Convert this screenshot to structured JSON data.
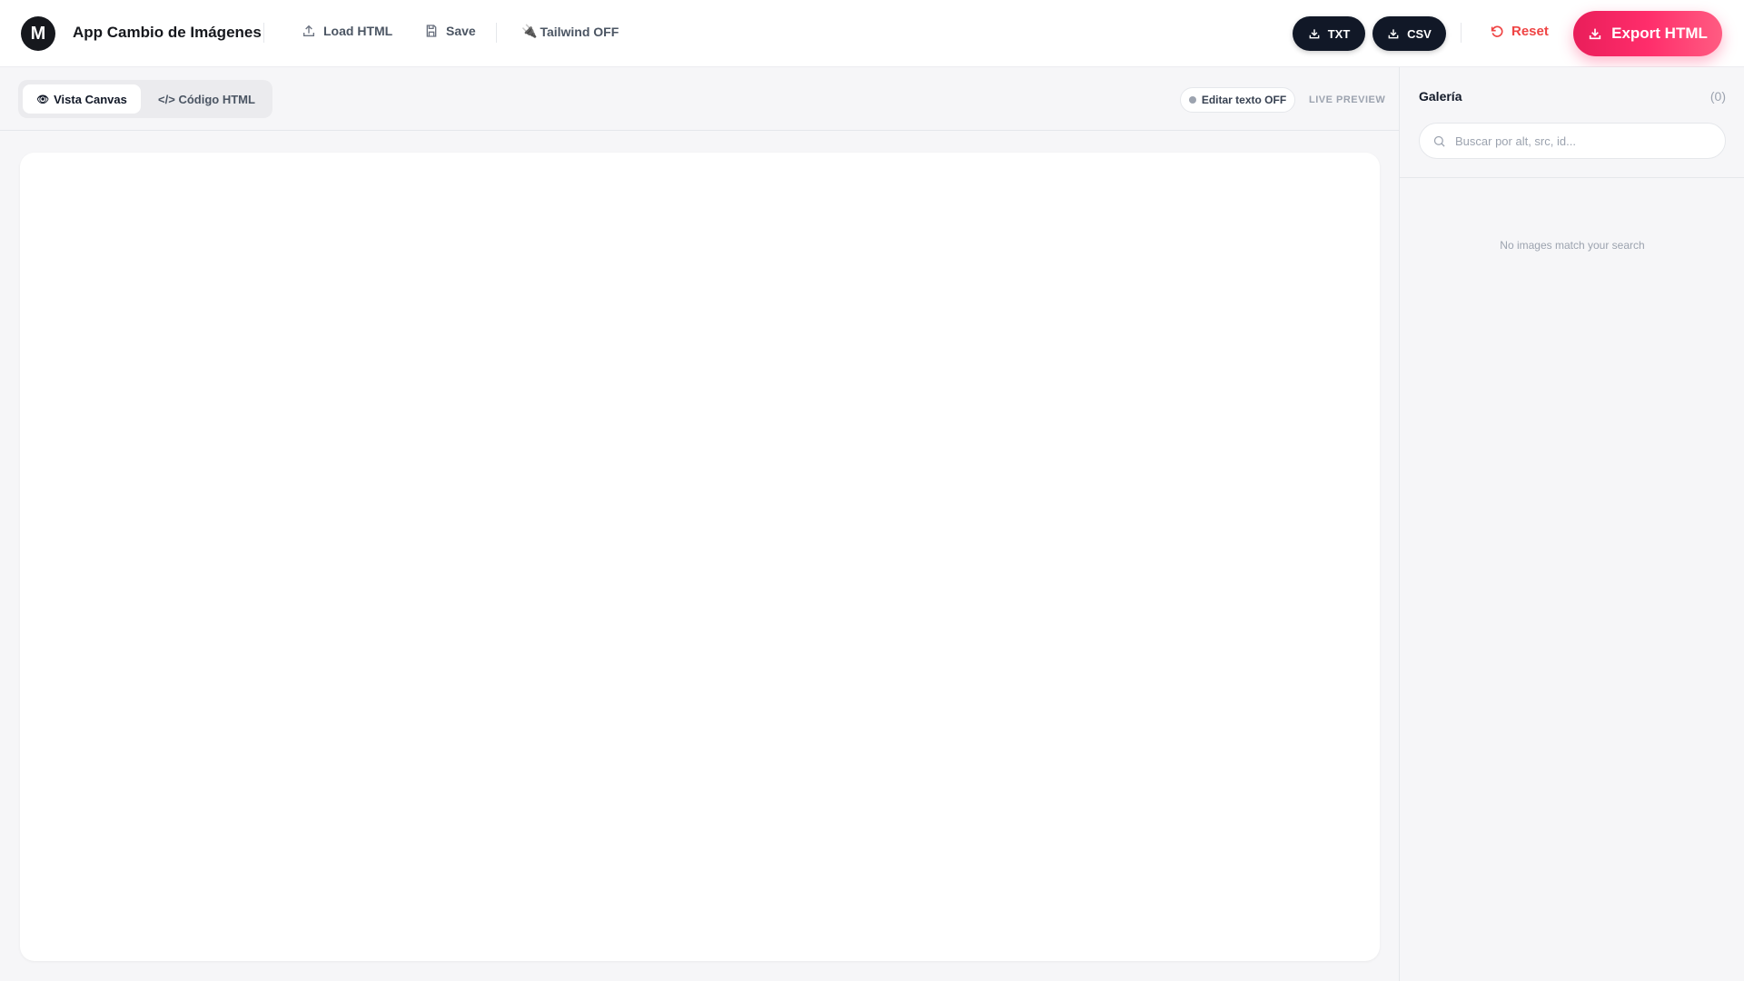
{
  "header": {
    "logo_letter": "M",
    "title": "App Cambio de Imágenes",
    "load_html": "Load HTML",
    "save": "Save",
    "tailwind": "Tailwind OFF",
    "txt": "TXT",
    "csv": "CSV",
    "reset": "Reset",
    "export": "Export HTML"
  },
  "toolbar": {
    "tab_canvas": "Vista Canvas",
    "tab_code": "</> Código HTML",
    "edit_text": "Editar texto OFF",
    "live_preview": "LIVE PREVIEW"
  },
  "gallery": {
    "title": "Galería",
    "count": "(0)",
    "search_placeholder": "Buscar por alt, src, id...",
    "empty": "No images match your search"
  }
}
